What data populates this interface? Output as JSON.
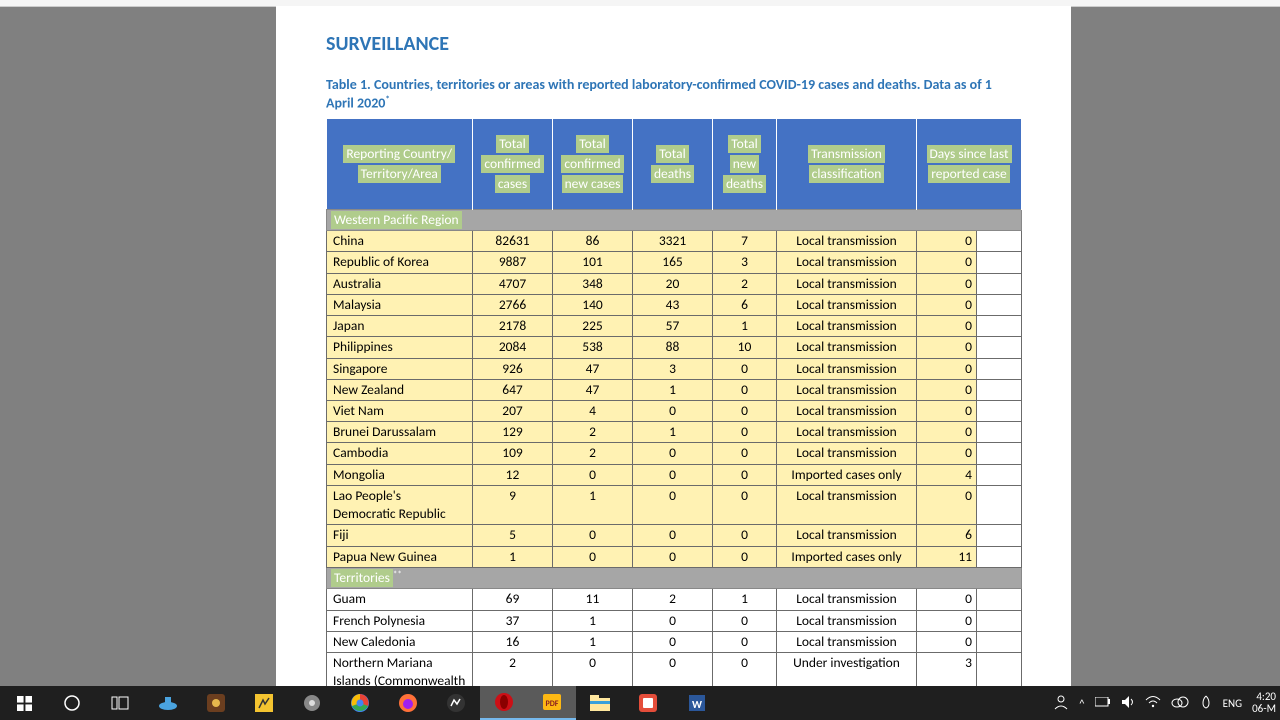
{
  "section_title": "SURVEILLANCE",
  "table_title": "Table 1. Countries, territories or areas with reported laboratory-confirmed COVID-19 cases and deaths. Data as of 1 April 2020",
  "table_title_sup": "*",
  "headers": {
    "h1a": "Reporting Country/",
    "h1b": "Territory/Area",
    "h2a": "Total",
    "h2b": "confirmed",
    "h2c": "cases",
    "h3a": "Total",
    "h3b": "confirmed",
    "h3c": "new cases",
    "h4a": "Total",
    "h4b": "deaths",
    "h5a": "Total",
    "h5b": "new",
    "h5c": "deaths",
    "h6a": "Transmission",
    "h6b": "classification",
    "h7a": "Days since last",
    "h7b": "reported case"
  },
  "region1": "Western Pacific Region",
  "region2": "Territories",
  "region2_sup": "**",
  "rows_r1": [
    {
      "country": "China",
      "c": "82631",
      "nc": "86",
      "d": "3321",
      "nd": "7",
      "t": "Local transmission",
      "days": "0"
    },
    {
      "country": "Republic of Korea",
      "c": "9887",
      "nc": "101",
      "d": "165",
      "nd": "3",
      "t": "Local transmission",
      "days": "0"
    },
    {
      "country": "Australia",
      "c": "4707",
      "nc": "348",
      "d": "20",
      "nd": "2",
      "t": "Local transmission",
      "days": "0"
    },
    {
      "country": "Malaysia",
      "c": "2766",
      "nc": "140",
      "d": "43",
      "nd": "6",
      "t": "Local transmission",
      "days": "0"
    },
    {
      "country": "Japan",
      "c": "2178",
      "nc": "225",
      "d": "57",
      "nd": "1",
      "t": "Local transmission",
      "days": "0"
    },
    {
      "country": "Philippines",
      "c": "2084",
      "nc": "538",
      "d": "88",
      "nd": "10",
      "t": "Local transmission",
      "days": "0"
    },
    {
      "country": "Singapore",
      "c": "926",
      "nc": "47",
      "d": "3",
      "nd": "0",
      "t": "Local transmission",
      "days": "0"
    },
    {
      "country": "New Zealand",
      "c": "647",
      "nc": "47",
      "d": "1",
      "nd": "0",
      "t": "Local transmission",
      "days": "0"
    },
    {
      "country": "Viet Nam",
      "c": "207",
      "nc": "4",
      "d": "0",
      "nd": "0",
      "t": "Local transmission",
      "days": "0"
    },
    {
      "country": "Brunei Darussalam",
      "c": "129",
      "nc": "2",
      "d": "1",
      "nd": "0",
      "t": "Local transmission",
      "days": "0"
    },
    {
      "country": "Cambodia",
      "c": "109",
      "nc": "2",
      "d": "0",
      "nd": "0",
      "t": "Local transmission",
      "days": "0"
    },
    {
      "country": "Mongolia",
      "c": "12",
      "nc": "0",
      "d": "0",
      "nd": "0",
      "t": "Imported cases only",
      "days": "4"
    }
  ],
  "row_lao_top": {
    "country": "Lao People's",
    "c": "9",
    "nc": "1",
    "d": "0",
    "nd": "0",
    "t": "Local transmission",
    "days": "0"
  },
  "row_lao_bot": {
    "country": "Democratic Republic"
  },
  "rows_r1b": [
    {
      "country": "Fiji",
      "c": "5",
      "nc": "0",
      "d": "0",
      "nd": "0",
      "t": "Local transmission",
      "days": "6"
    },
    {
      "country": "Papua New Guinea",
      "c": "1",
      "nc": "0",
      "d": "0",
      "nd": "0",
      "t": "Imported cases only",
      "days": "11"
    }
  ],
  "rows_r2": [
    {
      "country": "Guam",
      "c": "69",
      "nc": "11",
      "d": "2",
      "nd": "1",
      "t": "Local transmission",
      "days": "0"
    },
    {
      "country": "French Polynesia",
      "c": "37",
      "nc": "1",
      "d": "0",
      "nd": "0",
      "t": "Local transmission",
      "days": "0"
    },
    {
      "country": "New Caledonia",
      "c": "16",
      "nc": "1",
      "d": "0",
      "nd": "0",
      "t": "Local transmission",
      "days": "0"
    },
    {
      "country": "Northern Mariana Islands (Commonwealth of the)",
      "c": "2",
      "nc": "0",
      "d": "0",
      "nd": "0",
      "t": "Under investigation",
      "days": "3"
    }
  ],
  "tray": {
    "lang": "ENG",
    "time": "4:20",
    "date": "06-M"
  }
}
